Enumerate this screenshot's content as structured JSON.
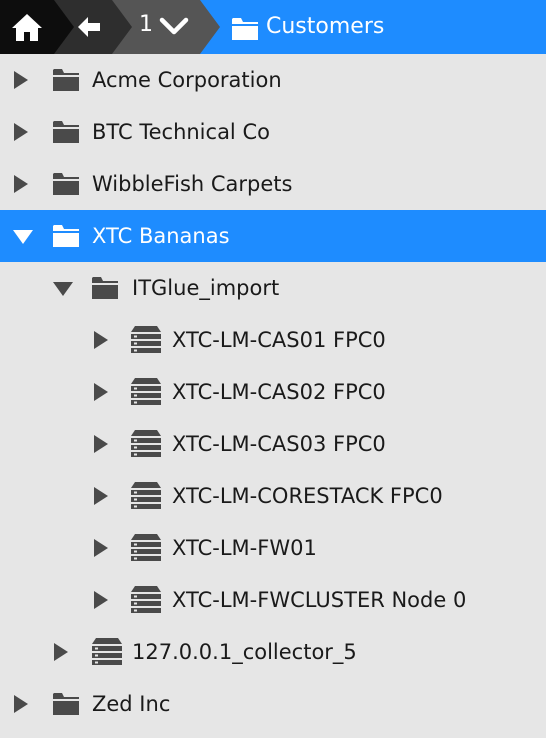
{
  "breadcrumb": {
    "home_icon": "home-icon",
    "back_icon": "back-arrow-icon",
    "level_number": "1",
    "level_icon": "chevron-down-icon",
    "current_icon": "folder-icon",
    "current_label": "Customers",
    "colors": {
      "home_bg": "#0d0d0d",
      "back_bg": "#2e2e2e",
      "level_bg": "#555555",
      "current_bg": "#1e8cff"
    }
  },
  "tree": {
    "colors": {
      "background": "#e6e6e6",
      "selected": "#1e8cff",
      "icon": "#4a4a4a"
    },
    "items": [
      {
        "label": "Acme Corporation",
        "icon": "folder-icon",
        "expanded": false,
        "selected": false
      },
      {
        "label": "BTC Technical Co",
        "icon": "folder-icon",
        "expanded": false,
        "selected": false
      },
      {
        "label": "WibbleFish Carpets",
        "icon": "folder-icon",
        "expanded": false,
        "selected": false
      },
      {
        "label": "XTC Bananas",
        "icon": "folder-icon",
        "expanded": true,
        "selected": true
      },
      {
        "label": "ITGlue_import",
        "icon": "folder-icon",
        "expanded": true,
        "selected": false
      },
      {
        "label": "XTC-LM-CAS01 FPC0",
        "icon": "server-icon",
        "expanded": false,
        "selected": false
      },
      {
        "label": "XTC-LM-CAS02 FPC0",
        "icon": "server-icon",
        "expanded": false,
        "selected": false
      },
      {
        "label": "XTC-LM-CAS03 FPC0",
        "icon": "server-icon",
        "expanded": false,
        "selected": false
      },
      {
        "label": "XTC-LM-CORESTACK FPC0",
        "icon": "server-icon",
        "expanded": false,
        "selected": false
      },
      {
        "label": "XTC-LM-FW01",
        "icon": "server-icon",
        "expanded": false,
        "selected": false
      },
      {
        "label": "XTC-LM-FWCLUSTER Node 0",
        "icon": "server-icon",
        "expanded": false,
        "selected": false
      },
      {
        "label": "127.0.0.1_collector_5",
        "icon": "server-icon",
        "expanded": false,
        "selected": false
      },
      {
        "label": "Zed Inc",
        "icon": "folder-icon",
        "expanded": false,
        "selected": false
      }
    ]
  }
}
